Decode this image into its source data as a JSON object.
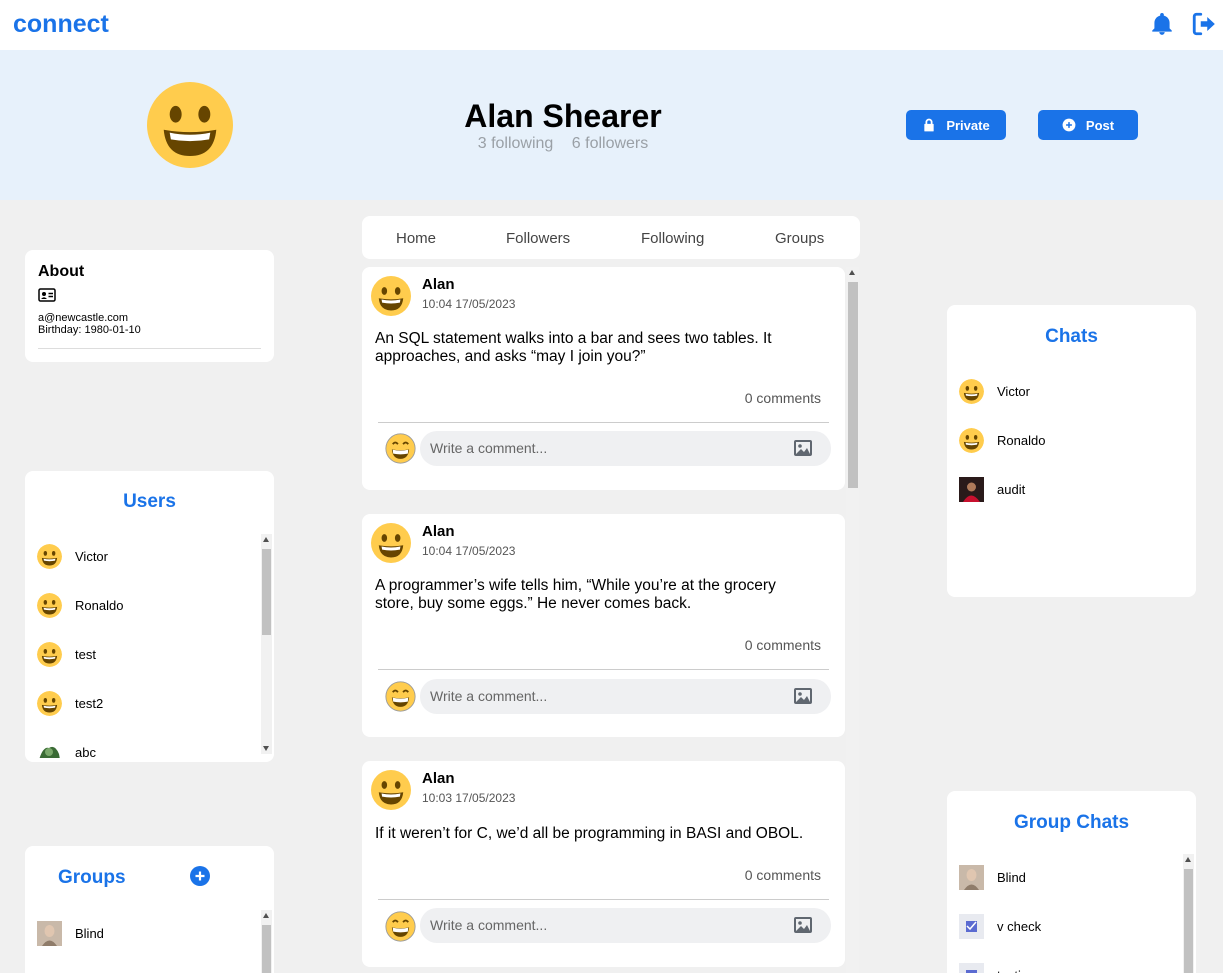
{
  "app": {
    "brand": "connect"
  },
  "profile": {
    "name": "Alan Shearer",
    "following": "3 following",
    "followers": "6 followers",
    "private_label": "Private",
    "post_label": "Post"
  },
  "about": {
    "title": "About",
    "email": "a@newcastle.com",
    "birthday": "Birthday: 1980-01-10"
  },
  "tabs": [
    "Home",
    "Followers",
    "Following",
    "Groups"
  ],
  "users": {
    "title": "Users",
    "items": [
      "Victor",
      "Ronaldo",
      "test",
      "test2",
      "abc"
    ]
  },
  "groups": {
    "title": "Groups",
    "items": [
      "Blind"
    ]
  },
  "chats": {
    "title": "Chats",
    "items": [
      "Victor",
      "Ronaldo",
      "audit"
    ]
  },
  "group_chats": {
    "title": "Group Chats",
    "items": [
      "Blind",
      "v check",
      "testing"
    ]
  },
  "posts": [
    {
      "author": "Alan",
      "time": "10:04 17/05/2023",
      "body": "An SQL statement walks into a bar and sees two tables. It approaches, and asks “may I join you?”",
      "comments": "0 comments"
    },
    {
      "author": "Alan",
      "time": "10:04 17/05/2023",
      "body": "A programmer’s wife tells him, “While you’re at the grocery store, buy some eggs.” He never comes back.",
      "comments": "0 comments"
    },
    {
      "author": "Alan",
      "time": "10:03 17/05/2023",
      "body": "If it weren’t for C, we’d all be programming in BASI and OBOL.",
      "comments": "0 comments"
    }
  ],
  "comment_placeholder": "Write a comment...",
  "colors": {
    "accent": "#1a73e8",
    "hero_bg": "#e7f1fb",
    "page_bg": "#f0f0f0"
  }
}
